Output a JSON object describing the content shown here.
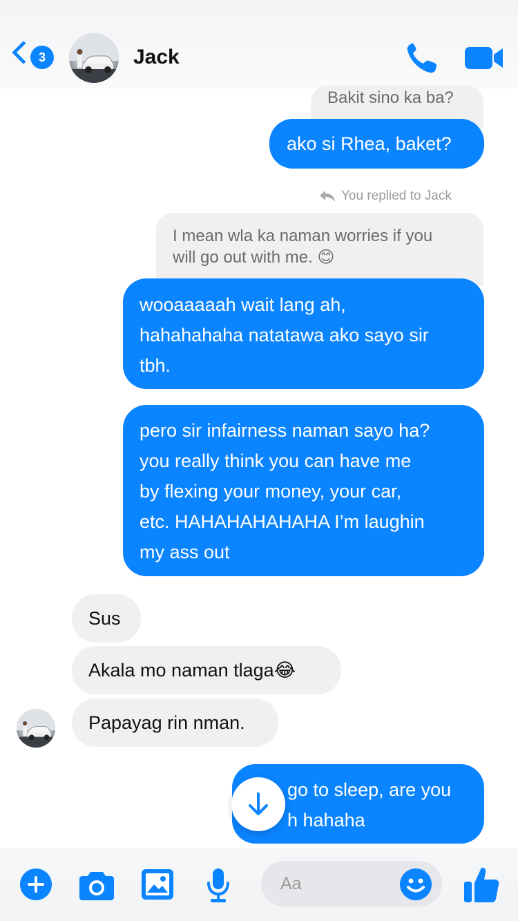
{
  "header": {
    "back_badge_count": "3",
    "contact_name": "Jack"
  },
  "messages": {
    "quoted_top": "Bakit sino ka ba?",
    "out_1": "ako si Rhea, baket?",
    "reply_note": "You replied to Jack",
    "quoted_reply_line1": "I mean wla ka naman worries if you",
    "quoted_reply_line2": "will go out with me. 😊",
    "out_2_line1": "wooaaaaah wait lang ah,",
    "out_2_line2": "hahahahaha natatawa ako sayo sir",
    "out_2_line3": "tbh.",
    "out_3_line1": "pero sir infairness naman sayo ha?",
    "out_3_line2": "you really think you can have me",
    "out_3_line3": "by flexing your money, your car,",
    "out_3_line4": "etc. HAHAHAHAHAHA I’m laughin",
    "out_3_line5": "my ass out",
    "in_1": "Sus",
    "in_2": "Akala mo naman tlaga😂",
    "in_3": "Papayag rin nman.",
    "out_4_line1": "go to sleep, are you",
    "out_4_line2": "h hahaha"
  },
  "composer": {
    "placeholder": "Aa"
  },
  "colors": {
    "accent": "#0a84ff",
    "incoming_bubble": "#f0f0f2"
  },
  "icons": {
    "back": "chevron-left-icon",
    "call": "phone-icon",
    "video": "video-camera-icon",
    "add": "plus-circle-icon",
    "camera": "camera-icon",
    "gallery": "image-icon",
    "mic": "microphone-icon",
    "emoji": "smiley-icon",
    "like": "thumbs-up-icon",
    "scroll": "arrow-down-icon"
  }
}
